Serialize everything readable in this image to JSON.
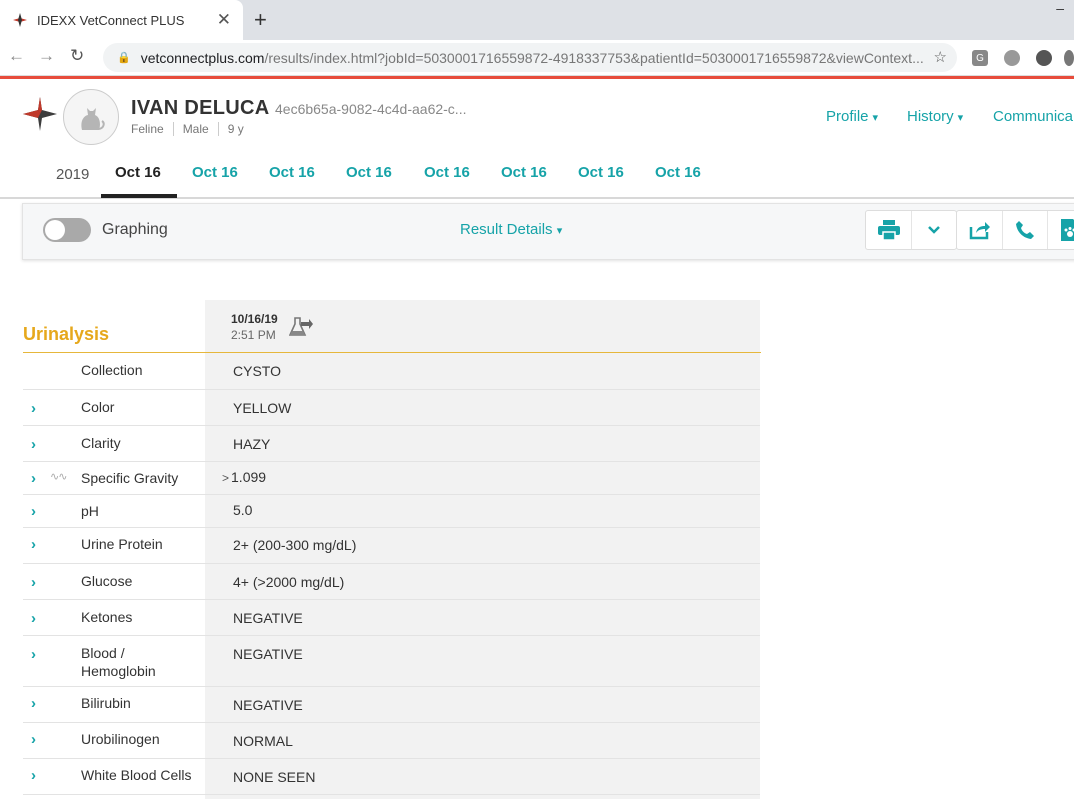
{
  "browser": {
    "tab_title": "IDEXX VetConnect PLUS",
    "url_host": "vetconnectplus.com",
    "url_path": "/results/index.html?jobId=5030001716559872-4918337753&patientId=5030001716559872&viewContext..."
  },
  "patient": {
    "name": "IVAN DELUCA",
    "id": "4ec6b65a-9082-4c4d-aa62-c...",
    "species": "Feline",
    "sex": "Male",
    "age": "9 y"
  },
  "nav": {
    "profile": "Profile",
    "history": "History",
    "communications": "Communica"
  },
  "date_tabs": {
    "year": "2019",
    "tabs": [
      "Oct 16",
      "Oct 16",
      "Oct 16",
      "Oct 16",
      "Oct 16",
      "Oct 16",
      "Oct 16",
      "Oct 16"
    ]
  },
  "toolbar": {
    "graphing_label": "Graphing",
    "result_details": "Result Details"
  },
  "results": {
    "section": "Urinalysis",
    "date": "10/16/19",
    "time": "2:51 PM",
    "rows": [
      {
        "name": "Collection",
        "value": "CYSTO",
        "flag": ""
      },
      {
        "name": "Color",
        "value": "YELLOW",
        "flag": ""
      },
      {
        "name": "Clarity",
        "value": "HAZY",
        "flag": ""
      },
      {
        "name": "Specific Gravity",
        "value": "1.099",
        "flag": ">"
      },
      {
        "name": "pH",
        "value": "5.0",
        "flag": ""
      },
      {
        "name": "Urine Protein",
        "value": "2+ (200-300 mg/dL)",
        "flag": ""
      },
      {
        "name": "Glucose",
        "value": "4+ (>2000 mg/dL)",
        "flag": ""
      },
      {
        "name": "Ketones",
        "value": "NEGATIVE",
        "flag": ""
      },
      {
        "name": "Blood / Hemoglobin",
        "value": "NEGATIVE",
        "flag": ""
      },
      {
        "name": "Bilirubin",
        "value": "NEGATIVE",
        "flag": ""
      },
      {
        "name": "Urobilinogen",
        "value": "NORMAL",
        "flag": ""
      },
      {
        "name": "White Blood Cells",
        "value": "NONE SEEN",
        "flag": ""
      }
    ]
  },
  "colors": {
    "accent": "#16a3a8",
    "section": "#e6a81c",
    "brand_red": "#e74c3c"
  }
}
